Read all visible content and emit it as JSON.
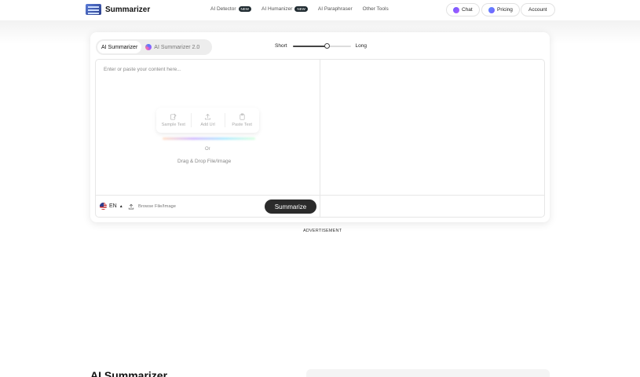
{
  "header": {
    "logo_text": "Summarizer",
    "nav": [
      {
        "label": "AI Detector",
        "badge": "NEW"
      },
      {
        "label": "AI Humanizer",
        "badge": "NEW"
      },
      {
        "label": "AI Paraphraser",
        "badge": ""
      },
      {
        "label": "Other Tools",
        "badge": ""
      }
    ],
    "chat_label": "Chat",
    "pricing_label": "Pricing",
    "account_label": "Account"
  },
  "tabs": [
    {
      "label": "AI Summarizer",
      "active": true
    },
    {
      "label": "AI Summarizer 2.0",
      "active": false
    }
  ],
  "length": {
    "short_label": "Short",
    "long_label": "Long",
    "value": 0.6
  },
  "editor": {
    "placeholder": "Enter or paste your content here...",
    "actions": [
      {
        "label": "Sample Text",
        "icon": "sample-text-icon"
      },
      {
        "label": "Add Url",
        "icon": "upload-icon"
      },
      {
        "label": "Paste Text",
        "icon": "clipboard-icon"
      }
    ],
    "or_text": "Or",
    "drag_text": "Drag & Drop File/Image",
    "language": "EN",
    "browse_label": "Browse File/Image",
    "summarize_label": "Summarize"
  },
  "advertisement_label": "ADVERTISEMENT",
  "section_title": "AI Summarizer",
  "colors": {
    "accent": "#2b2b2b",
    "badge": "#1f2a30"
  }
}
